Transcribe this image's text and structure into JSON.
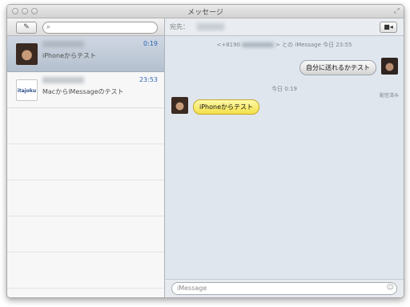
{
  "window": {
    "title": "メッセージ",
    "fullscreen_icon": "⤢"
  },
  "sidebar": {
    "compose_icon": "✎",
    "search_placeholder": "",
    "conversations": [
      {
        "time": "0:19",
        "preview": "iPhoneからテスト",
        "selected": true
      },
      {
        "time": "23:53",
        "preview": "MacからiMessageのテスト",
        "selected": false,
        "avatar_text": "itajoku"
      }
    ]
  },
  "main": {
    "to_label": "宛先：",
    "facetime_icon": "■◂",
    "info_prefix": "<+8190",
    "info_suffix": "> との iMessage 今日 23:55",
    "messages": [
      {
        "text": "自分に送れるかテスト",
        "side": "right"
      },
      {
        "text": "iPhoneからテスト",
        "side": "left"
      }
    ],
    "delivered": "配信済み",
    "date_label": "今日 0:19",
    "input_placeholder": "iMessage",
    "emoji_icon": "☺"
  }
}
